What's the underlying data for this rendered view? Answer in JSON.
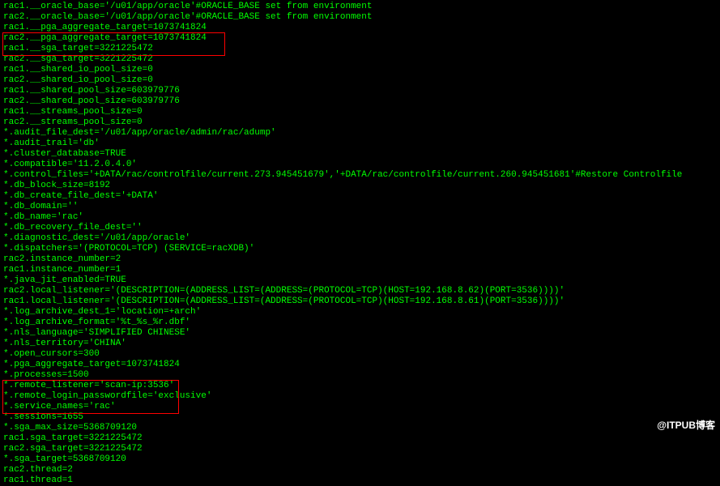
{
  "lines": [
    "rac1.__oracle_base='/u01/app/oracle'#ORACLE_BASE set from environment",
    "rac2.__oracle_base='/u01/app/oracle'#ORACLE_BASE set from environment",
    "rac1.__pga_aggregate_target=1073741824",
    "rac2.__pga_aggregate_target=1073741824",
    "rac1.__sga_target=3221225472",
    "rac2.__sga_target=3221225472",
    "rac1.__shared_io_pool_size=0",
    "rac2.__shared_io_pool_size=0",
    "rac1.__shared_pool_size=603979776",
    "rac2.__shared_pool_size=603979776",
    "rac1.__streams_pool_size=0",
    "rac2.__streams_pool_size=0",
    "*.audit_file_dest='/u01/app/oracle/admin/rac/adump'",
    "*.audit_trail='db'",
    "*.cluster_database=TRUE",
    "*.compatible='11.2.0.4.0'",
    "*.control_files='+DATA/rac/controlfile/current.273.945451679','+DATA/rac/controlfile/current.260.945451681'#Restore Controlfile",
    "*.db_block_size=8192",
    "*.db_create_file_dest='+DATA'",
    "*.db_domain=''",
    "*.db_name='rac'",
    "*.db_recovery_file_dest=''",
    "*.diagnostic_dest='/u01/app/oracle'",
    "*.dispatchers='(PROTOCOL=TCP) (SERVICE=racXDB)'",
    "rac2.instance_number=2",
    "rac1.instance_number=1",
    "*.java_jit_enabled=TRUE",
    "rac2.local_listener='(DESCRIPTION=(ADDRESS_LIST=(ADDRESS=(PROTOCOL=TCP)(HOST=192.168.8.62)(PORT=3536))))'",
    "rac1.local_listener='(DESCRIPTION=(ADDRESS_LIST=(ADDRESS=(PROTOCOL=TCP)(HOST=192.168.8.61)(PORT=3536))))'",
    "*.log_archive_dest_1='location=+arch'",
    "*.log_archive_format='%t_%s_%r.dbf'",
    "*.nls_language='SIMPLIFIED CHINESE'",
    "*.nls_territory='CHINA'",
    "*.open_cursors=300",
    "*.pga_aggregate_target=1073741824",
    "*.processes=1500",
    "*.remote_listener='scan-ip:3536'",
    "*.remote_login_passwordfile='exclusive'",
    "*.service_names='rac'",
    "*.sessions=1655",
    "*.sga_max_size=5368709120",
    "rac1.sga_target=3221225472",
    "rac2.sga_target=3221225472",
    "*.sga_target=5368709120",
    "rac2.thread=2",
    "rac1.thread=1"
  ],
  "watermark": "@ITPUB博客"
}
